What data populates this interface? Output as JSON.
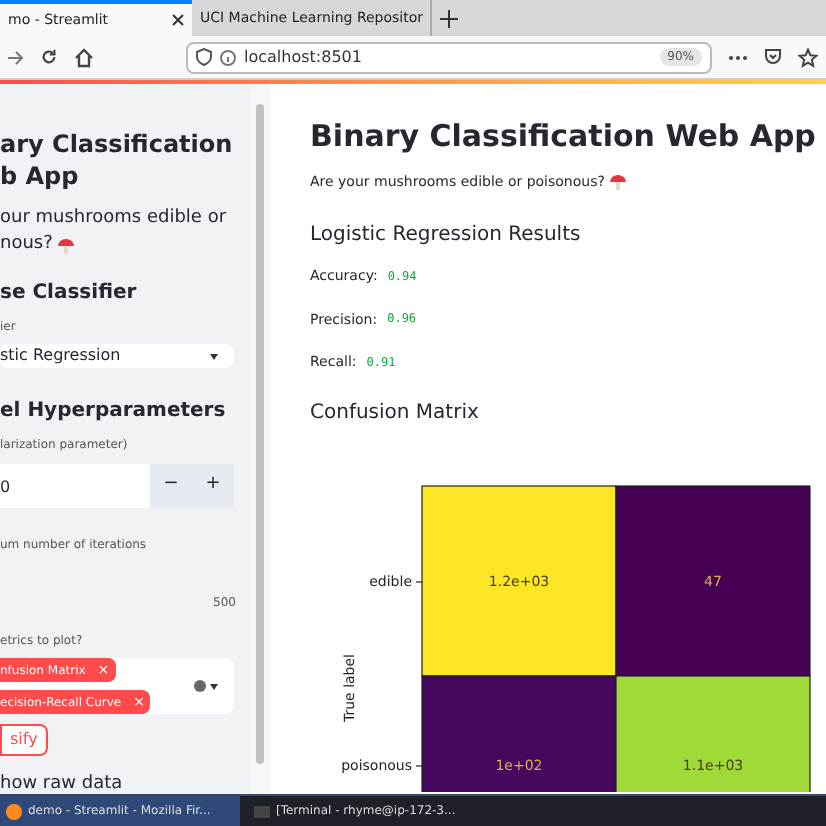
{
  "browser": {
    "tabs": [
      {
        "label": "mo - Streamlit",
        "selected": true
      },
      {
        "label": "UCI Machine Learning Repositor",
        "selected": false
      }
    ],
    "url": "localhost:8501",
    "zoom": "90%"
  },
  "sidebar": {
    "title_lines": [
      "ary Classification",
      "b App"
    ],
    "subtitle_lines": [
      "our mushrooms edible or",
      "nous?"
    ],
    "classifier_heading": "se Classifier",
    "classifier_label": "ier",
    "classifier_value": "stic Regression",
    "hyper_heading": "el Hyperparameters",
    "c_label": "larization parameter)",
    "c_value": "0",
    "minus": "−",
    "plus": "+",
    "iter_label": "um number of iterations",
    "iter_max": "500",
    "metrics_label": "etrics to plot?",
    "metric_tags": [
      "nfusion Matrix",
      "ecision-Recall Curve"
    ],
    "tag_close": "×",
    "classify_button": "sify",
    "raw_data_label": "how raw data"
  },
  "main": {
    "title": "Binary Classification Web App",
    "subtitle": "Are your mushrooms edible or poisonous?",
    "results_heading": "Logistic Regression Results",
    "metrics": [
      {
        "label": "Accuracy:",
        "value": "0.94"
      },
      {
        "label": "Precision:",
        "value": "0.96"
      },
      {
        "label": "Recall:",
        "value": "0.91"
      }
    ],
    "matrix_heading": "Confusion Matrix",
    "confusion_matrix": {
      "ylabel": "True label",
      "rows": [
        {
          "label": "edible",
          "cells": [
            {
              "text": "1.2e+03",
              "color": "#fde725"
            },
            {
              "text": "47",
              "color": "#440154"
            }
          ]
        },
        {
          "label": "poisonous",
          "cells": [
            {
              "text": "1e+02",
              "color": "#46085c"
            },
            {
              "text": "1.1e+03",
              "color": "#a0da39"
            }
          ]
        }
      ]
    }
  },
  "taskbar": {
    "items": [
      {
        "label": "demo - Streamlit - Mozilla Fir...",
        "selected": true
      },
      {
        "label": "[Terminal - rhyme@ip-172-3...",
        "selected": false
      }
    ]
  }
}
